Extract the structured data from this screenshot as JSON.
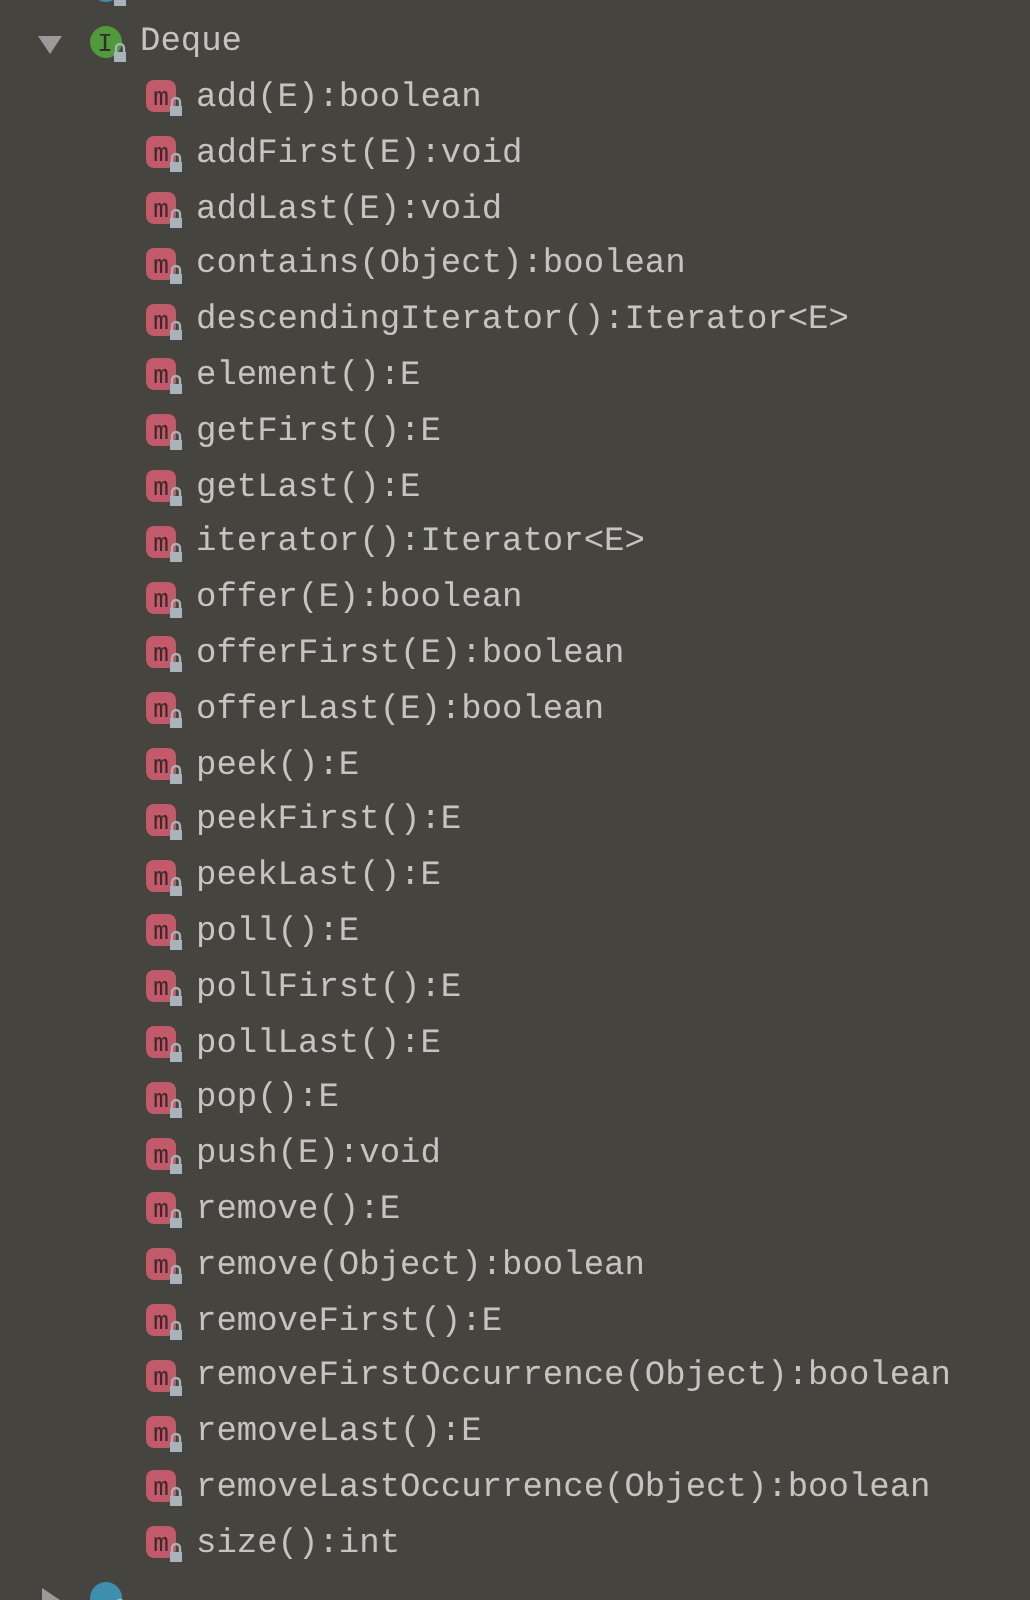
{
  "tree": [
    {
      "kind": "class"
    },
    {
      "kind": "interface",
      "badge": "I",
      "label": "Deque",
      "expanded": true,
      "children": [
        {
          "kind": "method",
          "badge": "m",
          "label": "add(E):boolean"
        },
        {
          "kind": "method",
          "badge": "m",
          "label": "addFirst(E):void"
        },
        {
          "kind": "method",
          "badge": "m",
          "label": "addLast(E):void"
        },
        {
          "kind": "method",
          "badge": "m",
          "label": "contains(Object):boolean"
        },
        {
          "kind": "method",
          "badge": "m",
          "label": "descendingIterator():Iterator<E>"
        },
        {
          "kind": "method",
          "badge": "m",
          "label": "element():E"
        },
        {
          "kind": "method",
          "badge": "m",
          "label": "getFirst():E"
        },
        {
          "kind": "method",
          "badge": "m",
          "label": "getLast():E"
        },
        {
          "kind": "method",
          "badge": "m",
          "label": "iterator():Iterator<E>"
        },
        {
          "kind": "method",
          "badge": "m",
          "label": "offer(E):boolean"
        },
        {
          "kind": "method",
          "badge": "m",
          "label": "offerFirst(E):boolean"
        },
        {
          "kind": "method",
          "badge": "m",
          "label": "offerLast(E):boolean"
        },
        {
          "kind": "method",
          "badge": "m",
          "label": "peek():E"
        },
        {
          "kind": "method",
          "badge": "m",
          "label": "peekFirst():E"
        },
        {
          "kind": "method",
          "badge": "m",
          "label": "peekLast():E"
        },
        {
          "kind": "method",
          "badge": "m",
          "label": "poll():E"
        },
        {
          "kind": "method",
          "badge": "m",
          "label": "pollFirst():E"
        },
        {
          "kind": "method",
          "badge": "m",
          "label": "pollLast():E"
        },
        {
          "kind": "method",
          "badge": "m",
          "label": "pop():E"
        },
        {
          "kind": "method",
          "badge": "m",
          "label": "push(E):void"
        },
        {
          "kind": "method",
          "badge": "m",
          "label": "remove():E"
        },
        {
          "kind": "method",
          "badge": "m",
          "label": "remove(Object):boolean"
        },
        {
          "kind": "method",
          "badge": "m",
          "label": "removeFirst():E"
        },
        {
          "kind": "method",
          "badge": "m",
          "label": "removeFirstOccurrence(Object):boolean"
        },
        {
          "kind": "method",
          "badge": "m",
          "label": "removeLast():E"
        },
        {
          "kind": "method",
          "badge": "m",
          "label": "removeLastOccurrence(Object):boolean"
        },
        {
          "kind": "method",
          "badge": "m",
          "label": "size():int"
        }
      ]
    },
    {
      "kind": "class",
      "expanded": false
    }
  ]
}
